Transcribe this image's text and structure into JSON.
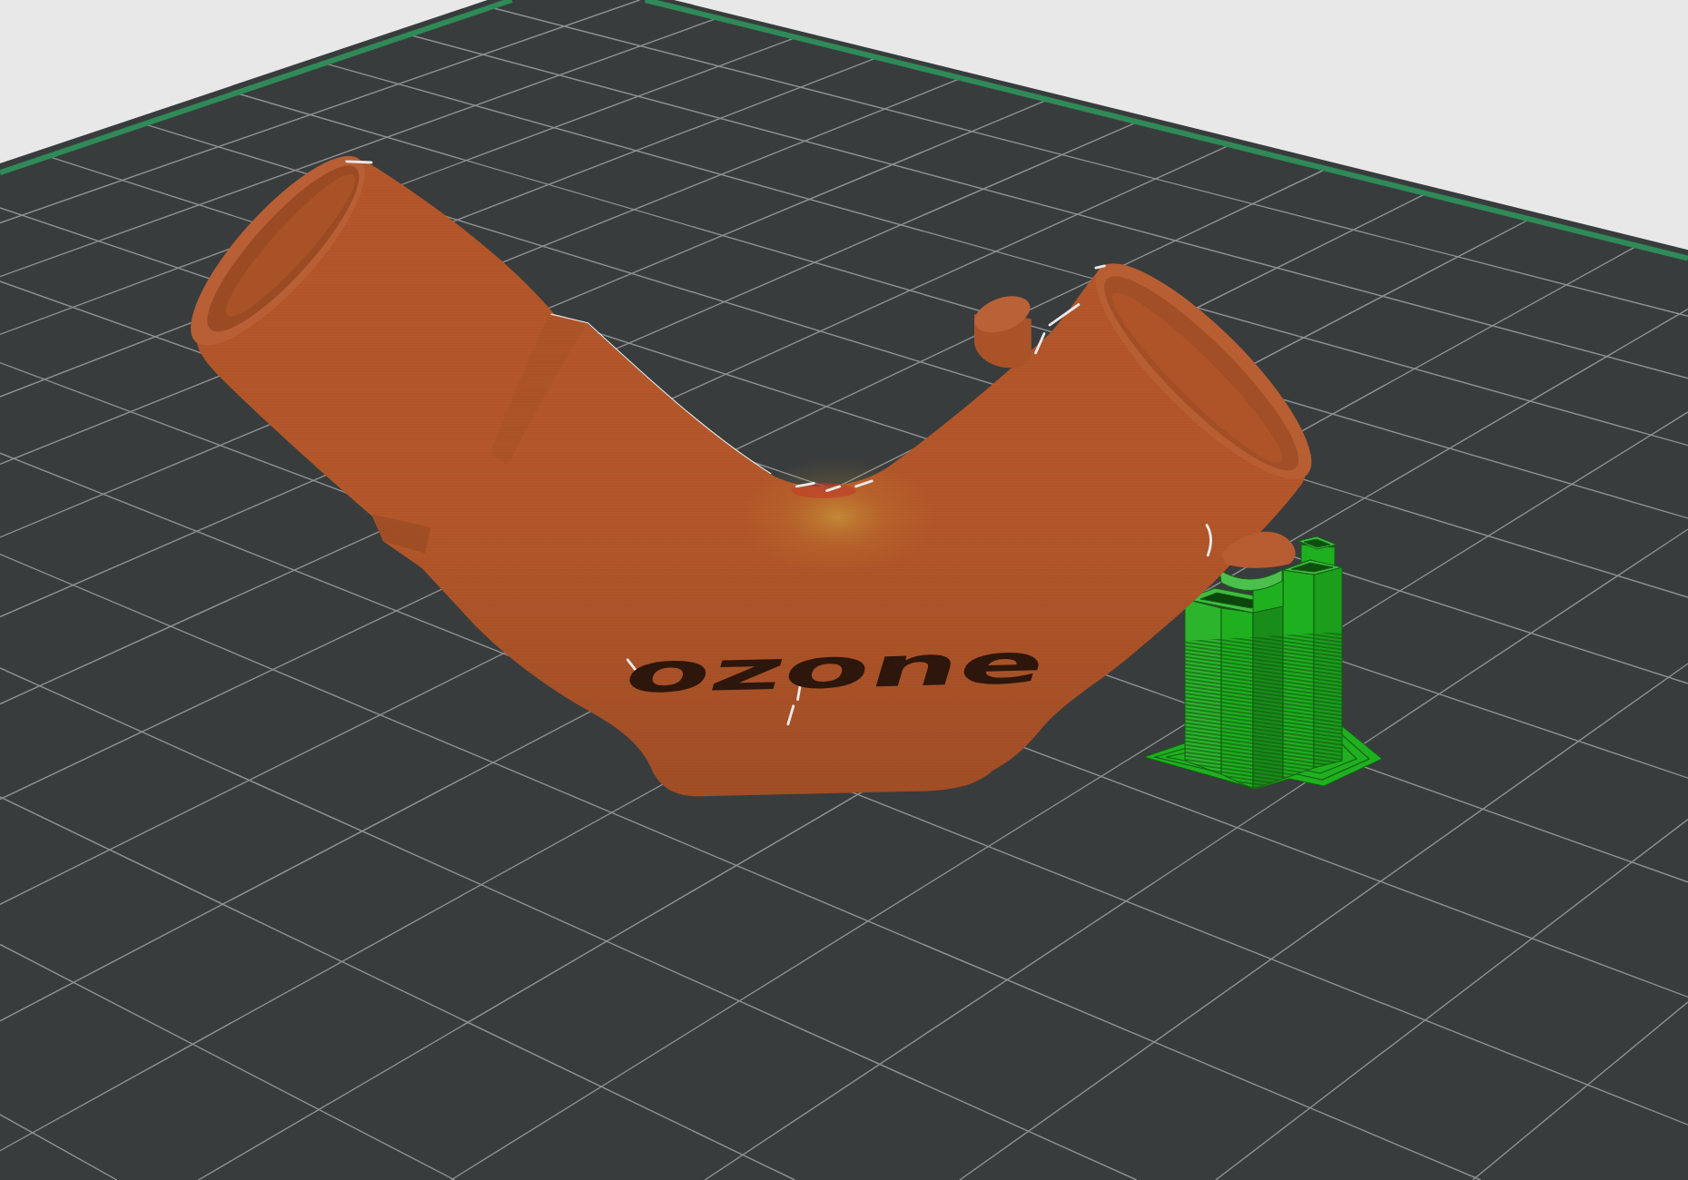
{
  "viewport": {
    "objects": [
      {
        "kind": "model",
        "color": "#b4572a",
        "engraving": "ozone"
      },
      {
        "kind": "support",
        "color": "#1fb01f"
      }
    ]
  }
}
